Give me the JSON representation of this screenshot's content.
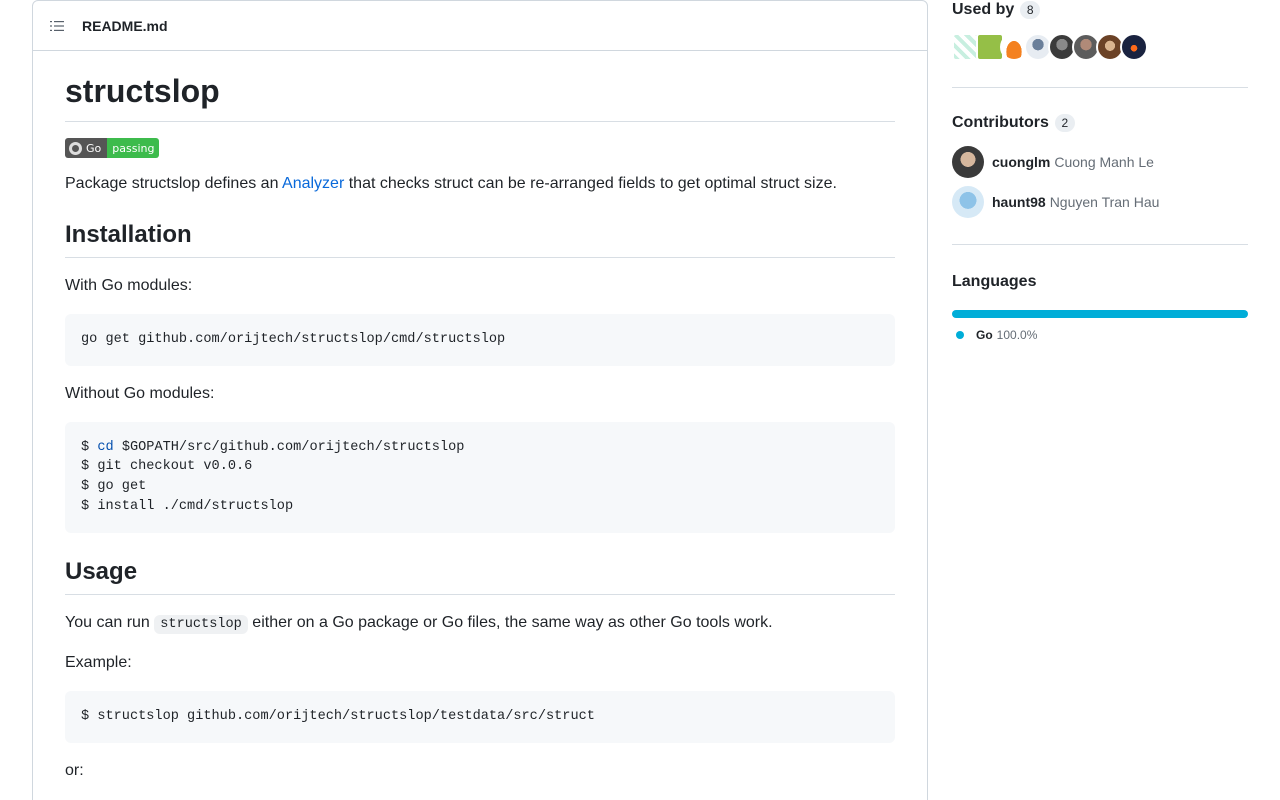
{
  "readme": {
    "filename": "README.md",
    "title": "structslop",
    "badge": {
      "left": "Go",
      "right": "passing"
    },
    "intro": {
      "before": "Package structslop defines an ",
      "link": "Analyzer",
      "after": " that checks struct can be re-arranged fields to get optimal struct size."
    },
    "installation": {
      "heading": "Installation",
      "with_modules": "With Go modules:",
      "with_modules_cmd": "go get github.com/orijtech/structslop/cmd/structslop",
      "without_modules": "Without Go modules:",
      "without_modules_lines": [
        {
          "prompt": "$ ",
          "kw": "cd",
          "rest": " $GOPATH/src/github.com/orijtech/structslop"
        },
        {
          "prompt": "$ ",
          "kw": "",
          "rest": "git checkout v0.0.6"
        },
        {
          "prompt": "$ ",
          "kw": "",
          "rest": "go get"
        },
        {
          "prompt": "$ ",
          "kw": "",
          "rest": "install ./cmd/structslop"
        }
      ]
    },
    "usage": {
      "heading": "Usage",
      "text_before": "You can run ",
      "inline_code": "structslop",
      "text_after": " either on a Go package or Go files, the same way as other Go tools work.",
      "example_label": "Example:",
      "example_cmd": "$ structslop github.com/orijtech/structslop/testdata/src/struct",
      "or_label": "or:"
    }
  },
  "sidebar": {
    "used_by": {
      "label": "Used by",
      "count": "8"
    },
    "contributors": {
      "label": "Contributors",
      "count": "2",
      "items": [
        {
          "login": "cuonglm",
          "name": "Cuong Manh Le"
        },
        {
          "login": "haunt98",
          "name": "Nguyen Tran Hau"
        }
      ]
    },
    "languages": {
      "label": "Languages",
      "items": [
        {
          "name": "Go",
          "percent": "100.0%",
          "color": "#00add8",
          "fraction": 1.0
        }
      ]
    }
  },
  "colors": {
    "link": "#0969da",
    "badge_pass": "#3dbb4c",
    "go_lang": "#00add8"
  }
}
